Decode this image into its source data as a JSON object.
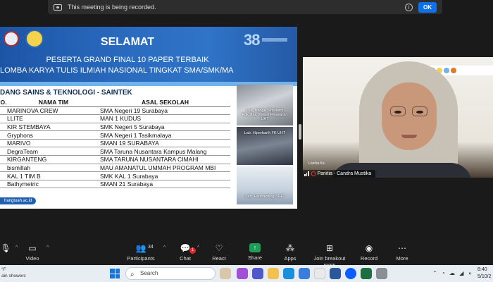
{
  "recording_banner": {
    "text": "This meeting is being recorded.",
    "ok_label": "OK"
  },
  "slide": {
    "title": "SELAMAT",
    "subtitle_line1": "PESERTA GRAND FINAL 10 PAPER TERBAIK",
    "subtitle_line2": "LOMBA KARYA TULIS ILMIAH NASIONAL TINGKAT SMA/SMK/MA",
    "logo_number": "38",
    "section": "DANG SAINS & TEKNOLOGI - SAINTEK",
    "table": {
      "headers": [
        "O.",
        "NAMA TIM",
        "ASAL SEKOLAH"
      ],
      "rows": [
        [
          "",
          "MARINOVA CREW",
          "SMA Negeri 19 Surabaya"
        ],
        [
          "",
          "LLITE",
          "MAN 1 KUDUS"
        ],
        [
          "",
          "KIR STEMBAYA",
          "SMK Negeri 5 Surabaya"
        ],
        [
          "",
          "Gryphons",
          "SMA Negeri 1 Tasikmalaya"
        ],
        [
          "",
          "MARIVO",
          "SMAN 19 SURABAYA"
        ],
        [
          "",
          "DegraTeam",
          "SMA Taruna Nusantara Kampus Malang"
        ],
        [
          "",
          "KIRGANTENG",
          "SMA TARUNA NUSANTARA CIMAHI"
        ],
        [
          "",
          "bismillah",
          "MAU AMANATUL UMMAH PROGRAM MBI"
        ],
        [
          "",
          "KAL 1 TIM B",
          "SMK KAL 1 Surabaya"
        ],
        [
          "",
          "Bathymetric",
          "SMAN 21 Surabaya"
        ]
      ]
    },
    "url": "hangtuah.ac.id",
    "photos": [
      {
        "caption": "Lab. Bridge Simulator Fakultas Vokasi Pelayaran UHT"
      },
      {
        "caption": "Lab. Hiperbarik FK UHT"
      },
      {
        "caption": "Lab. Farmakologi UHT"
      }
    ]
  },
  "participant": {
    "name": "Panitia - Candra Mustika",
    "overlay_text": "Lomba Ka"
  },
  "toolbar": {
    "items": [
      {
        "label": "",
        "icon": "mic-icon"
      },
      {
        "label": "Video",
        "icon": "video-icon"
      },
      {
        "label": "Participants",
        "icon": "participants-icon",
        "count": "34"
      },
      {
        "label": "Chat",
        "icon": "chat-icon",
        "badge": "1"
      },
      {
        "label": "React",
        "icon": "react-icon"
      },
      {
        "label": "Share",
        "icon": "share-icon"
      },
      {
        "label": "Apps",
        "icon": "apps-icon"
      },
      {
        "label": "Join breakout room",
        "icon": "breakout-icon"
      },
      {
        "label": "Record",
        "icon": "record-icon"
      },
      {
        "label": "More",
        "icon": "more-icon"
      }
    ]
  },
  "taskbar": {
    "weather_line1": "°F",
    "weather_line2": "ain showers",
    "search_placeholder": "Search",
    "time": "8:40",
    "date": "5/10/2"
  },
  "colors": {
    "slide_blue": "#2a6cc0",
    "zoom_blue": "#0e71eb",
    "share_green": "#1e9e55",
    "record_red": "#e02828"
  }
}
